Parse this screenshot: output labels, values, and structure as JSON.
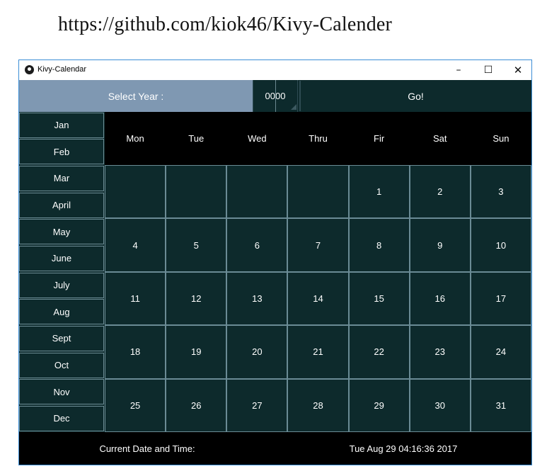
{
  "caption": "https://github.com/kiok46/Kivy-Calender",
  "window": {
    "title": "Kivy-Calendar",
    "minimize_icon": "minimize-icon",
    "maximize_icon": "maximize-icon",
    "close_icon": "close-icon"
  },
  "topbar": {
    "select_year_label": "Select Year :",
    "year_value": "0000",
    "go_label": "Go!"
  },
  "months": [
    "Jan",
    "Feb",
    "Mar",
    "April",
    "May",
    "June",
    "July",
    "Aug",
    "Sept",
    "Oct",
    "Nov",
    "Dec"
  ],
  "days": [
    "Mon",
    "Tue",
    "Wed",
    "Thru",
    "Fir",
    "Sat",
    "Sun"
  ],
  "weeks": [
    [
      "",
      "",
      "",
      "",
      "1",
      "2",
      "3"
    ],
    [
      "4",
      "5",
      "6",
      "7",
      "8",
      "9",
      "10"
    ],
    [
      "11",
      "12",
      "13",
      "14",
      "15",
      "16",
      "17"
    ],
    [
      "18",
      "19",
      "20",
      "21",
      "22",
      "23",
      "24"
    ],
    [
      "25",
      "26",
      "27",
      "28",
      "29",
      "30",
      "31"
    ]
  ],
  "footer": {
    "label": "Current Date and Time:",
    "value": "Tue Aug 29 04:16:36 2017"
  },
  "colors": {
    "panel": "#0d2a2c",
    "header": "#000000",
    "select_year_bg": "#7f98b2",
    "cell_border": "#6a8b95",
    "window_border": "#3c8ed6"
  }
}
